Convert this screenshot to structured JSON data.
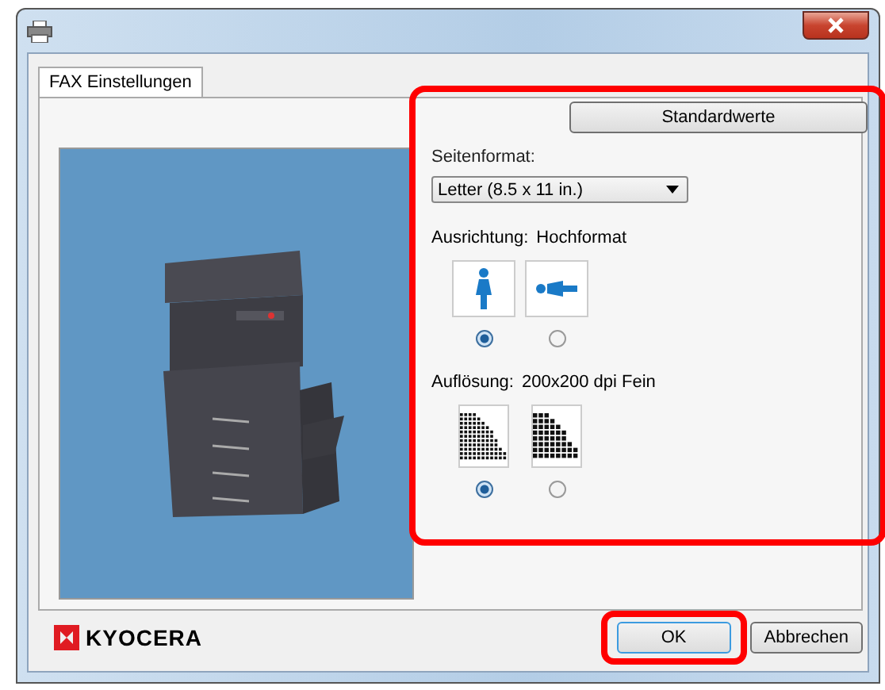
{
  "tabs": [
    {
      "label": "FAX Einstellungen",
      "selected": true
    }
  ],
  "defaults_button": "Standardwerte",
  "page_size": {
    "label": "Seitenformat:",
    "value": "Letter (8.5 x 11 in.)"
  },
  "orientation": {
    "label": "Ausrichtung:",
    "value": "Hochformat",
    "options": [
      {
        "kind": "portrait",
        "selected": true
      },
      {
        "kind": "landscape",
        "selected": false
      }
    ]
  },
  "resolution": {
    "label": "Auflösung:",
    "value": "200x200 dpi Fein",
    "options": [
      {
        "kind": "fine",
        "selected": true
      },
      {
        "kind": "normal",
        "selected": false
      }
    ]
  },
  "logo": "KYOCERA",
  "buttons": [
    {
      "label": "OK",
      "highlighted": true
    },
    {
      "label": "Abbrechen",
      "highlighted": false
    }
  ]
}
